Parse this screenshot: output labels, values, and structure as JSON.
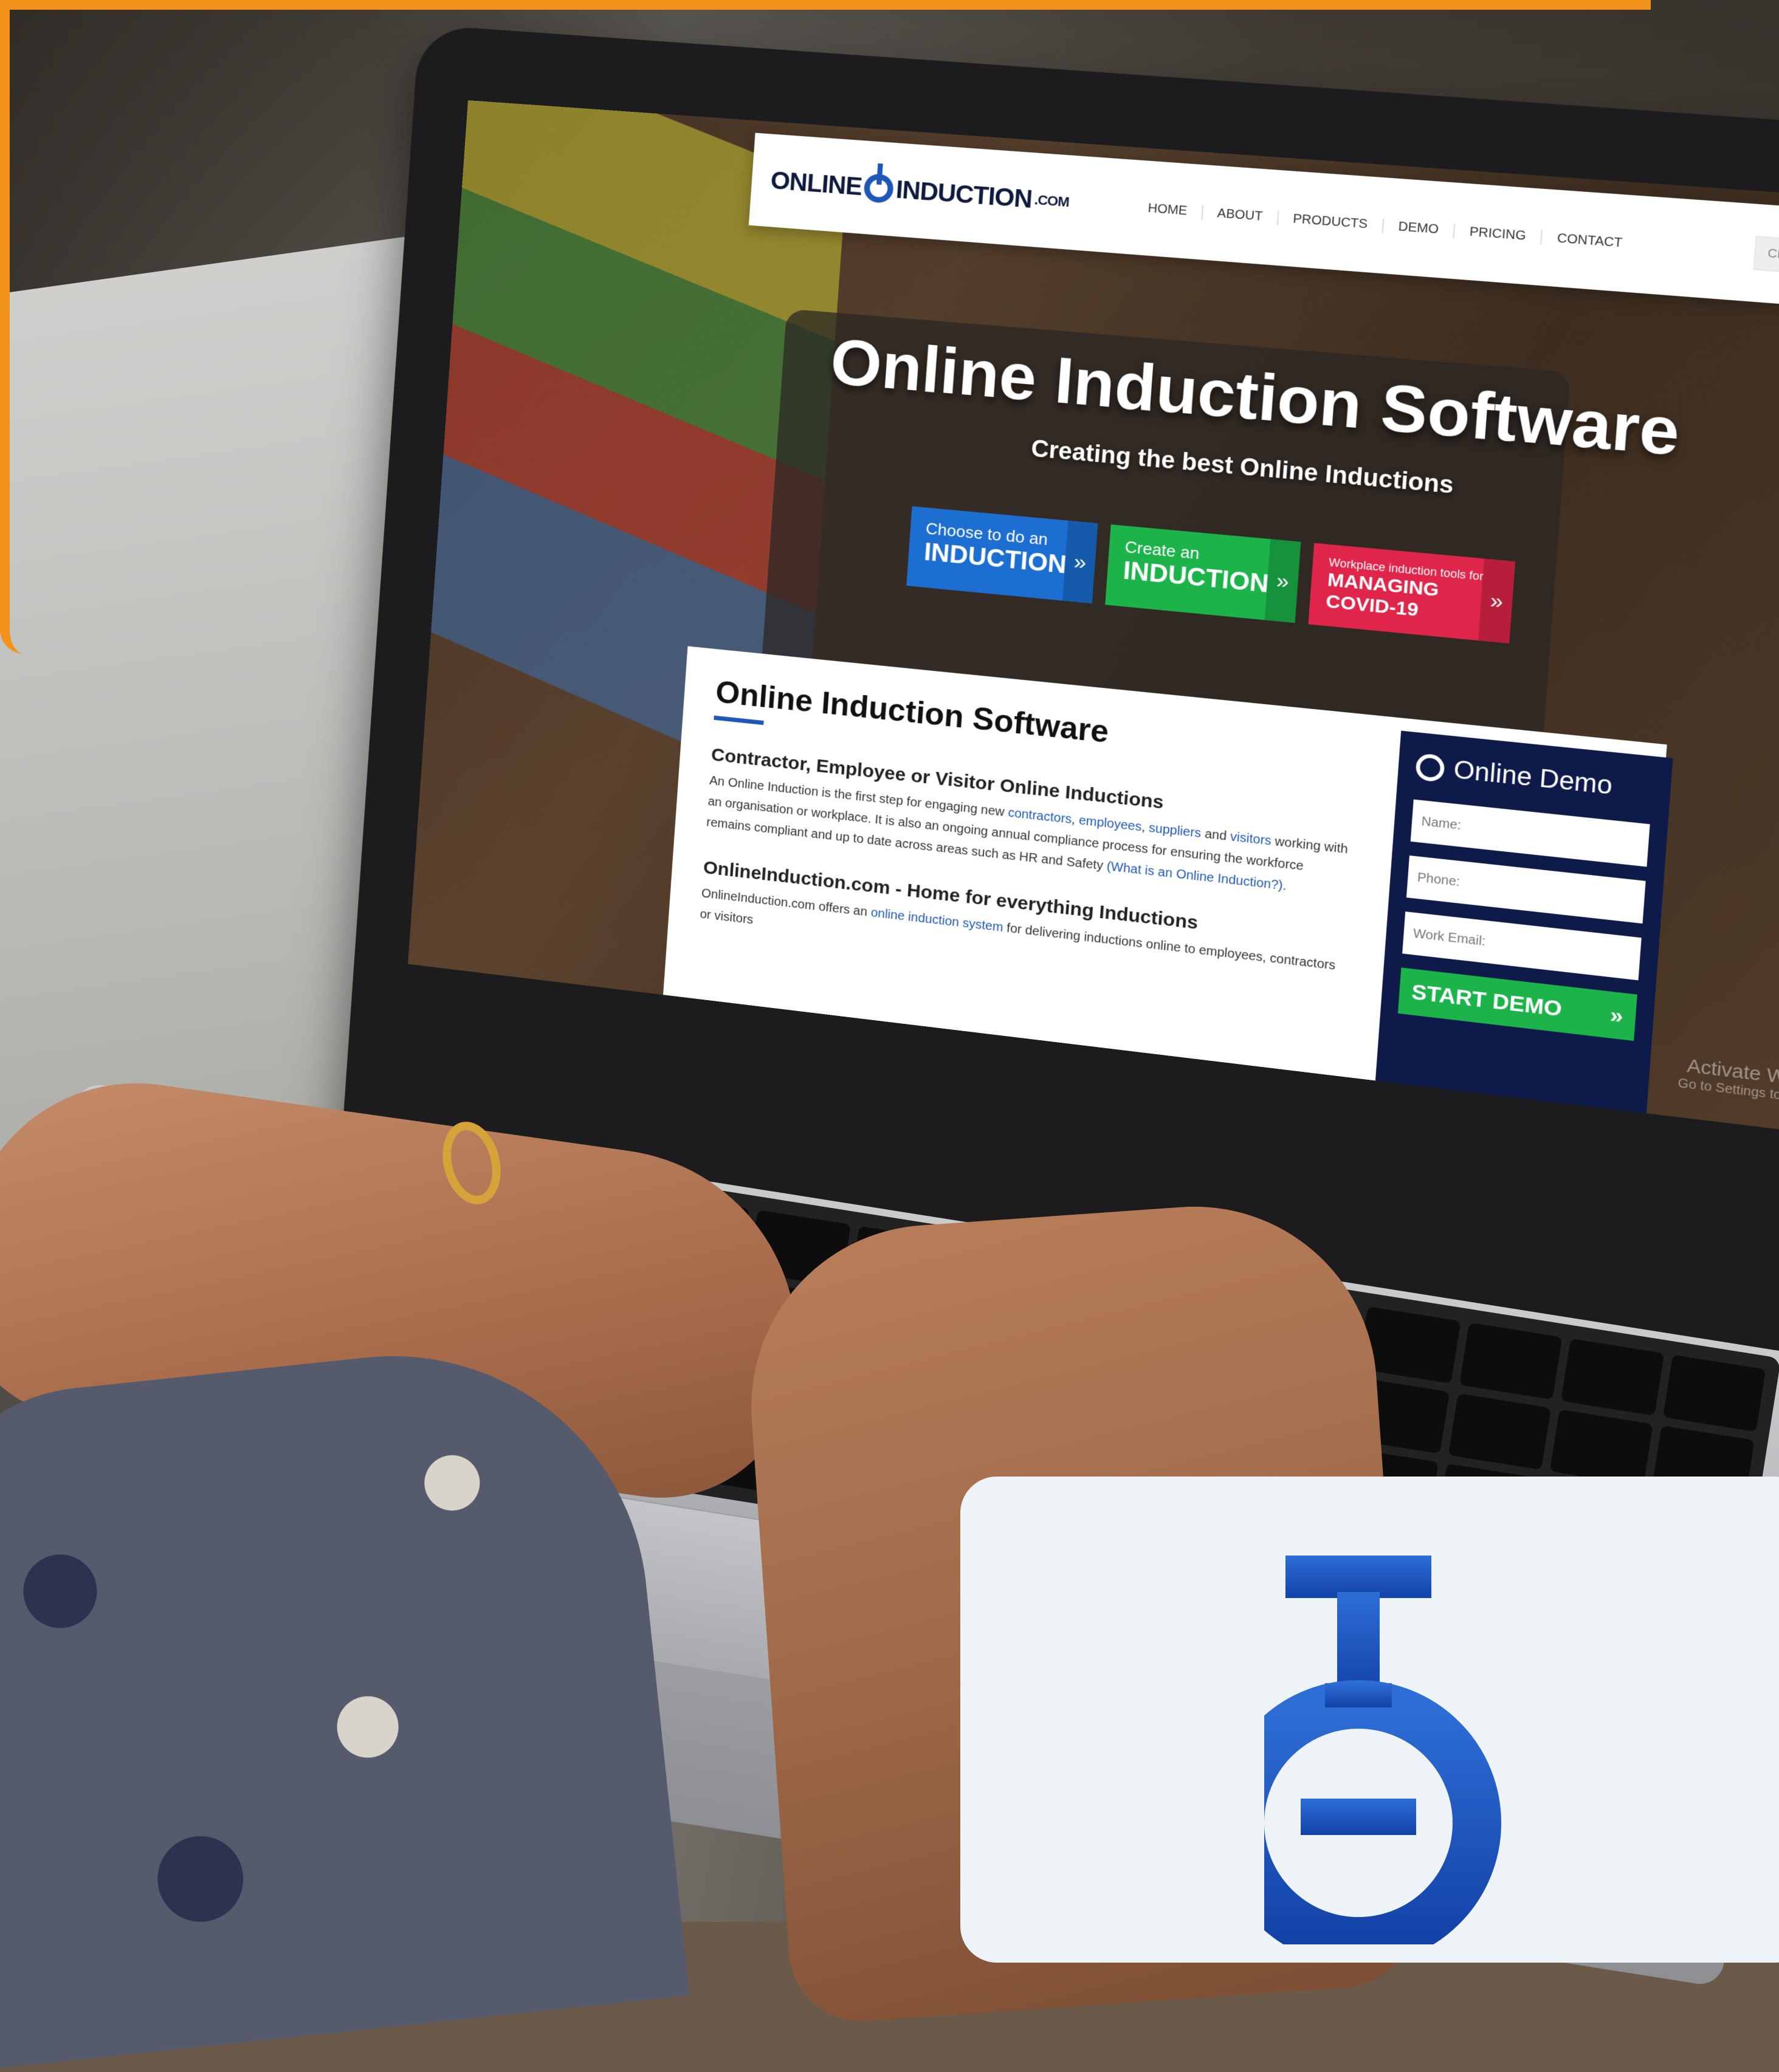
{
  "site": {
    "logo": {
      "left": "ONLINE",
      "right": "INDUCTION",
      "suffix": ".COM"
    },
    "nav": [
      "HOME",
      "ABOUT",
      "PRODUCTS",
      "DEMO",
      "PRICING",
      "CONTACT"
    ],
    "portal_placeholder": "CREATE PORTAL",
    "hero": {
      "title": "Online Induction Software",
      "subtitle": "Creating the best Online Inductions"
    },
    "ctas": [
      {
        "small": "Choose to do an",
        "big": "INDUCTION",
        "color": "#1c6fd1"
      },
      {
        "small": "Create an",
        "big": "INDUCTION",
        "color": "#1bb34a"
      },
      {
        "small": "Workplace induction tools for",
        "big": "MANAGING COVID-19",
        "color": "#e0254a"
      }
    ],
    "content": {
      "title": "Online Induction Software",
      "section1_heading": "Contractor, Employee or Visitor Online Inductions",
      "section1_text_a": "An Online Induction is the first step for engaging new ",
      "link_contractors": "contractors",
      "link_employees": "employees",
      "link_suppliers": "suppliers",
      "text_and": " and ",
      "link_visitors": "visitors",
      "section1_text_b": " working with an organisation or workplace. It is also an ongoing annual compliance process for ensuring the workforce remains compliant and up to date across areas such as HR and Safety ",
      "link_what": "(What is an Online Induction?).",
      "section2_heading": "OnlineInduction.com - Home for everything Inductions",
      "section2_text_a": "OnlineInduction.com offers an ",
      "link_system": "online induction system",
      "section2_text_b": " for delivering inductions online to employees, contractors or visitors"
    },
    "demo": {
      "title": "Online Demo",
      "fields": [
        "Name:",
        "Phone:",
        "Work Email:"
      ],
      "button": "START DEMO",
      "button_arrow": "»"
    },
    "cta_arrow": "»",
    "watermark": {
      "main": "Activate Windows",
      "sub": "Go to Settings to activate W"
    }
  },
  "colors": {
    "frame": "#f2931e",
    "brand_blue": "#1f57b9",
    "demo_navy": "#0e1a4a"
  },
  "icons": [
    "search-icon",
    "headset-icon",
    "chevron-double-right-icon",
    "induction-logo-icon"
  ]
}
